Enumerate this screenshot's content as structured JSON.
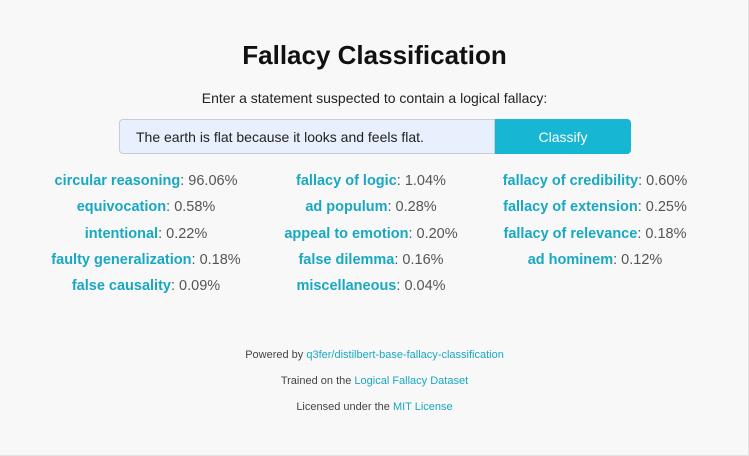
{
  "header": {
    "title": "Fallacy Classification",
    "subtitle": "Enter a statement suspected to contain a logical fallacy:"
  },
  "form": {
    "input_value": "The earth is flat because it looks and feels flat.",
    "button_label": "Classify"
  },
  "accent_color": "#18a8c2",
  "button_color": "#17b6d2",
  "results": [
    {
      "label": "circular reasoning",
      "value": "96.06%"
    },
    {
      "label": "fallacy of logic",
      "value": "1.04%"
    },
    {
      "label": "fallacy of credibility",
      "value": "0.60%"
    },
    {
      "label": "equivocation",
      "value": "0.58%"
    },
    {
      "label": "ad populum",
      "value": "0.28%"
    },
    {
      "label": "fallacy of extension",
      "value": "0.25%"
    },
    {
      "label": "intentional",
      "value": "0.22%"
    },
    {
      "label": "appeal to emotion",
      "value": "0.20%"
    },
    {
      "label": "fallacy of relevance",
      "value": "0.18%"
    },
    {
      "label": "faulty generalization",
      "value": "0.18%"
    },
    {
      "label": "false dilemma",
      "value": "0.16%"
    },
    {
      "label": "ad hominem",
      "value": "0.12%"
    },
    {
      "label": "false causality",
      "value": "0.09%"
    },
    {
      "label": "miscellaneous",
      "value": "0.04%"
    }
  ],
  "footer": {
    "powered_prefix": "Powered by ",
    "powered_link": "q3fer/distilbert-base-fallacy-classification",
    "trained_prefix": "Trained on the ",
    "trained_link": "Logical Fallacy Dataset",
    "license_prefix": "Licensed under the ",
    "license_link": "MIT License"
  }
}
